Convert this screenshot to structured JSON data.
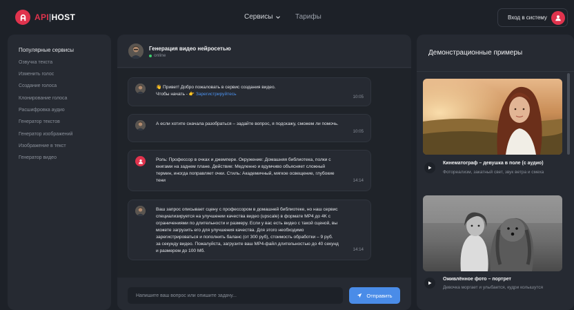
{
  "header": {
    "logo_api": "API",
    "logo_sep": "|",
    "logo_host": "HOST",
    "nav_services": "Сервисы",
    "nav_tariffs": "Тарифы",
    "login_label": "Вход в систему"
  },
  "sidebar": {
    "title": "Популярные сервисы",
    "items": [
      {
        "label": "Озвучка текста"
      },
      {
        "label": "Изменить голос"
      },
      {
        "label": "Создание голоса"
      },
      {
        "label": "Клонирование голоса"
      },
      {
        "label": "Расшифровка аудио"
      },
      {
        "label": "Генератор текстов"
      },
      {
        "label": "Генератор изображений"
      },
      {
        "label": "Изображение в текст"
      },
      {
        "label": "Генератор видео"
      }
    ]
  },
  "chat": {
    "title": "Генерация видео нейросетью",
    "status": "online",
    "messages": [
      {
        "line1": "👋 Привет! Добро пожаловать в сервис создания видео.",
        "line2_prefix": "Чтобы начать - 👉 ",
        "link": "Зарегистрируйтесь",
        "time": "10:05"
      },
      {
        "text": "А если хотите сначала разобраться – задайте вопрос, я подскажу, сможем ли помочь.",
        "time": "10:05"
      },
      {
        "text": "Роль: Профессор в очках и джемпере. Окружение: Домашняя библиотека, полки с книгами на заднем плане. Действие: Медленно и вдумчиво объясняет сложный термин, иногда поправляет очки. Стиль: Академичный, мягкое освещение, глубокие тени",
        "time": "14:14"
      },
      {
        "text": "Ваш запрос описывает сцену с профессором в домашней библиотеке, но наш сервис специализируется на улучшении качества видео (upscale) в формате MP4 до 4K с ограничениями по длительности и размеру. Если у вас есть видео с такой сценой, вы можете загрузить его для улучшения качества. Для этого необходимо зарегистрироваться и пополнить баланс (от 300 руб), стоимость обработки – 9 руб. за секунду видео. Пожалуйста, загрузите ваш MP4-файл длительностью до 40 секунд и размером до 100 Мб.",
        "time": "14:14"
      }
    ],
    "input_placeholder": "Напишите ваш вопрос или опишите задачу...",
    "send_label": "Отправить"
  },
  "demo": {
    "title": "Демонстрационные примеры",
    "cards": [
      {
        "title": "Кинематограф – девушка в поле (с аудио)",
        "desc": "Фотореализм, закатный свет, звук ветра и смеха"
      },
      {
        "title": "Оживлённое фото – портрет",
        "desc": "Девочка моргает и улыбается, кудри колышутся"
      }
    ]
  },
  "colors": {
    "accent": "#e0334d",
    "button_blue": "#4a8ce8",
    "background": "#1d2128",
    "panel": "#262a32"
  }
}
